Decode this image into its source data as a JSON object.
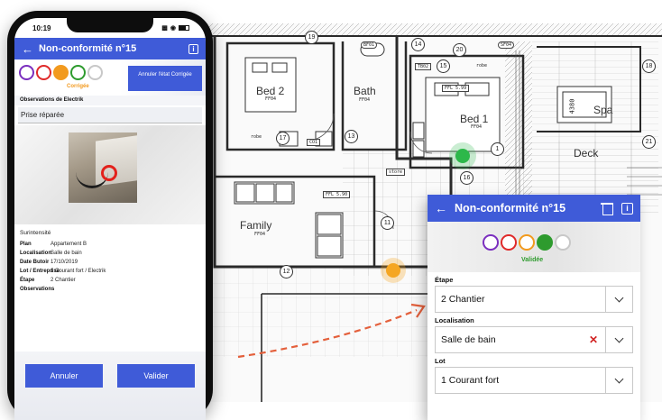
{
  "phone": {
    "statusbar": {
      "time": "10:19"
    },
    "appbar": {
      "title": "Non-conformité n°15"
    },
    "status": {
      "dot_colors": [
        "#7b2fbf",
        "#e02a2a",
        "#f29a1e",
        "#2e9b2e",
        "#c8c8c8"
      ],
      "active_label": "Corrigée",
      "cancel_button": "Annuler l'état Corrigée"
    },
    "observations": {
      "title": "Observations de Electrik",
      "value": "Prise réparée"
    },
    "details": {
      "heading": "Surintensité",
      "rows": [
        {
          "label": "Plan",
          "value": "Appartement B"
        },
        {
          "label": "Localisation",
          "value": "Salle de bain"
        },
        {
          "label": "Date Butoir",
          "value": "17/10/2019"
        },
        {
          "label": "Lot / Entreprise",
          "value": "1 Courant fort / Electrik"
        },
        {
          "label": "Étape",
          "value": "2 Chantier"
        },
        {
          "label": "Observations",
          "value": ""
        }
      ]
    },
    "buttons": {
      "cancel": "Annuler",
      "validate": "Valider"
    }
  },
  "card": {
    "title": "Non-conformité n°15",
    "status": {
      "dot_colors": [
        "#7b2fbf",
        "#e02a2a",
        "#f29a1e",
        "#2e9b2e",
        "#c8c8c8"
      ],
      "active_label": "Validée"
    },
    "fields": [
      {
        "label": "Étape",
        "value": "2 Chantier"
      },
      {
        "label": "Localisation",
        "value": "Salle de bain"
      },
      {
        "label": "Lot",
        "value": "1 Courant fort"
      }
    ]
  },
  "plan": {
    "rooms": [
      "Bed 2",
      "Bath",
      "Bed 1",
      "Spa",
      "Deck",
      "Family"
    ],
    "tags": [
      "FF04",
      "FF04",
      "FF04",
      "FF04",
      "FFL 5.99",
      "FFL 5.90",
      "BF01",
      "SF04",
      "TB02",
      "robe",
      "robe",
      "store",
      "CO1",
      "4380"
    ],
    "markers": [
      "#2db84a",
      "#f5a623"
    ],
    "numbers": [
      "19",
      "20",
      "15",
      "14",
      "17",
      "16",
      "12",
      "11",
      "13",
      "1",
      "18",
      "21"
    ]
  }
}
